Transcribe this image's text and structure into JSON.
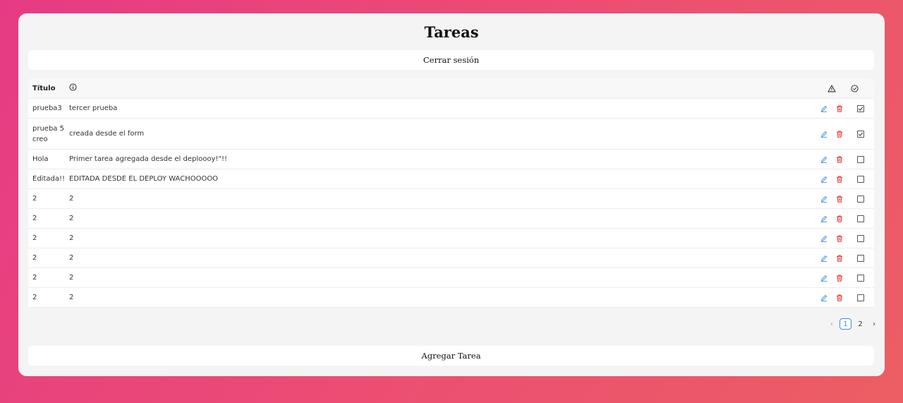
{
  "header": {
    "title": "Tareas"
  },
  "logout_label": "Cerrar sesión",
  "table": {
    "col_title": "Título",
    "tasks": [
      {
        "title": "prueba3",
        "description": "tercer prueba",
        "done": true
      },
      {
        "title": "prueba 5 creo",
        "description": "creada desde el form",
        "done": true
      },
      {
        "title": "Hola",
        "description": "Primer tarea agregada desde el deploooy!\"!!",
        "done": false
      },
      {
        "title": "Editada!!",
        "description": "EDITADA DESDE EL DEPLOY WACHOOOOO",
        "done": false
      },
      {
        "title": "2",
        "description": "2",
        "done": false
      },
      {
        "title": "2",
        "description": "2",
        "done": false
      },
      {
        "title": "2",
        "description": "2",
        "done": false
      },
      {
        "title": "2",
        "description": "2",
        "done": false
      },
      {
        "title": "2",
        "description": "2",
        "done": false
      },
      {
        "title": "2",
        "description": "2",
        "done": false
      }
    ]
  },
  "pagination": {
    "pages": [
      "1",
      "2"
    ],
    "current": "1"
  },
  "add_label": "Agregar Tarea",
  "colors": {
    "edit": "#3a8ee6",
    "delete": "#e52a2a",
    "accent": "#3a8ee6"
  },
  "icons": {
    "info": "info-circle-icon",
    "warning": "warning-triangle-icon",
    "done": "check-circle-icon",
    "edit": "pencil-icon",
    "delete": "trash-icon"
  }
}
